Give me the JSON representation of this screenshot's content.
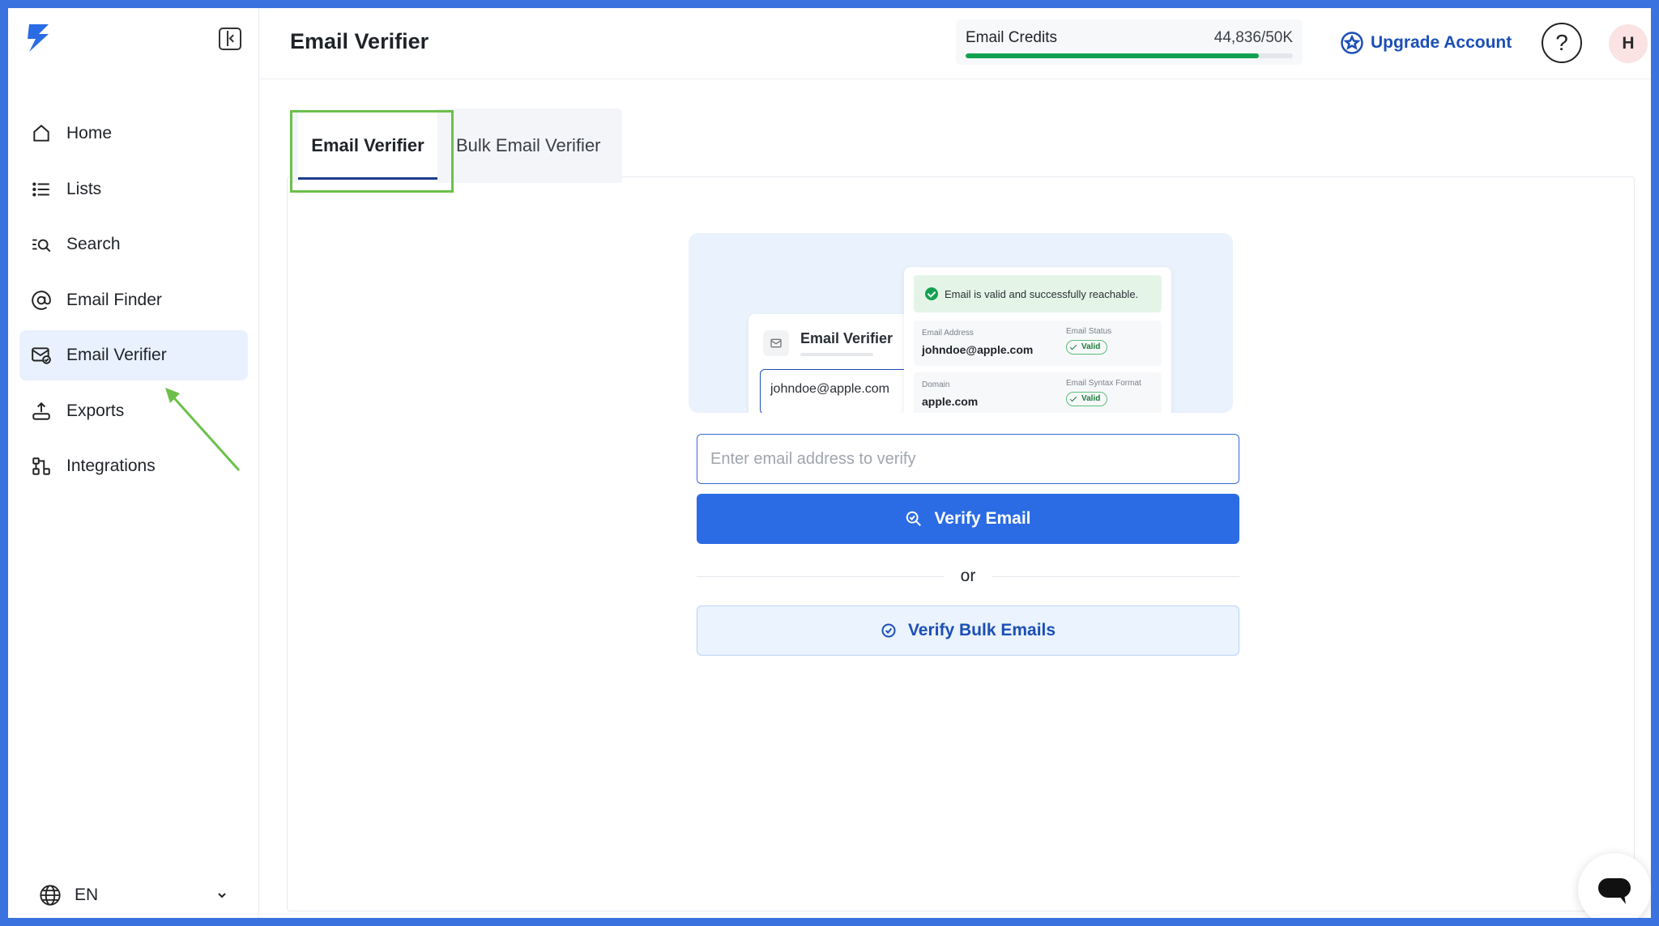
{
  "sidebar": {
    "items": [
      {
        "label": "Home",
        "icon": "home-icon"
      },
      {
        "label": "Lists",
        "icon": "list-icon"
      },
      {
        "label": "Search",
        "icon": "search-icon"
      },
      {
        "label": "Email Finder",
        "icon": "at-sign-icon"
      },
      {
        "label": "Email Verifier",
        "icon": "mail-check-icon",
        "active": true
      },
      {
        "label": "Exports",
        "icon": "export-icon"
      },
      {
        "label": "Integrations",
        "icon": "integrations-icon"
      }
    ],
    "language": "EN"
  },
  "header": {
    "title": "Email Verifier",
    "credits": {
      "label": "Email Credits",
      "count": "44,836/50K",
      "used": 44836,
      "total": 50000
    },
    "upgrade_label": "Upgrade Account",
    "help_label": "?",
    "avatar_initial": "H"
  },
  "tabs": [
    {
      "label": "Email Verifier",
      "active": true
    },
    {
      "label": "Bulk Email Verifier",
      "active": false
    }
  ],
  "illustration": {
    "card_title": "Email Verifier",
    "card_input_value": "johndoe@apple.com",
    "banner_text": "Email is valid and successfully reachable.",
    "rows": [
      {
        "label": "Email Address",
        "value": "johndoe@apple.com",
        "status_label": "Email Status",
        "status": "Valid"
      },
      {
        "label": "Domain",
        "value": "apple.com",
        "status_label": "Email Syntax Format",
        "status": "Valid"
      }
    ]
  },
  "form": {
    "placeholder": "Enter email address to verify",
    "verify_label": "Verify Email",
    "or_label": "or",
    "bulk_label": "Verify Bulk Emails"
  },
  "colors": {
    "frame_border": "#3a72e0",
    "primary": "#2b6be4",
    "accent_dark": "#1c4fb6",
    "credits_bar": "#12a150",
    "highlight": "#6cc04a"
  }
}
